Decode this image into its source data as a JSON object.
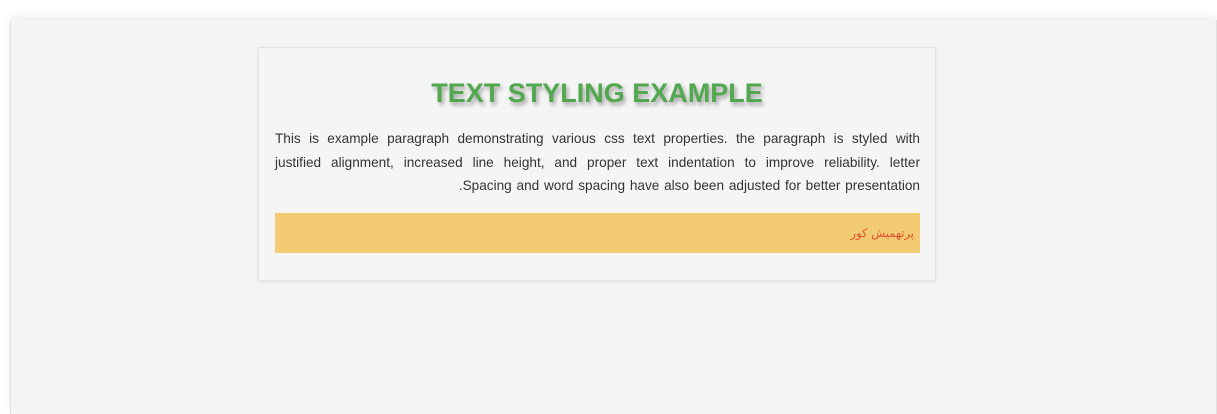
{
  "heading": "TEXT STYLING EXAMPLE",
  "paragraph": {
    "lines": [
      "This is example paragraph demonstrating various css text properties. the paragraph is styled with",
      "justified alignment, increased line height, and proper text indentation to improve reliability. letter",
      "Spacing and word spacing have also been adjusted for better presentation."
    ]
  },
  "highlight_text": "پرتهمیش کور",
  "colors": {
    "heading": "#52a84f",
    "highlight_bg": "#f2cb72",
    "highlight_text": "#e0522f",
    "body_text": "#333333"
  }
}
